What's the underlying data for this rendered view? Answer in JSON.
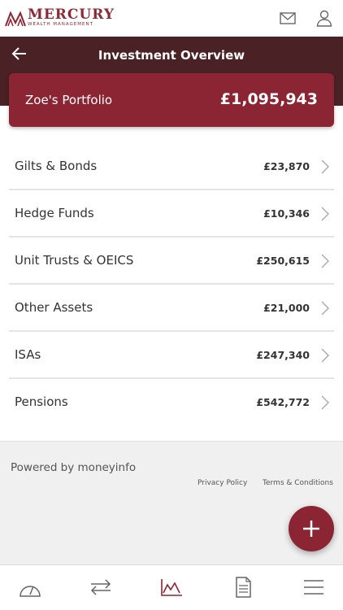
{
  "brand": {
    "name": "MERCURY",
    "subtitle": "WEALTH MANAGEMENT",
    "color": "#8b2533"
  },
  "header": {
    "title": "Investment Overview",
    "back_icon": "arrow-left-icon"
  },
  "portfolio": {
    "name": "Zoe's Portfolio",
    "total": "£1,095,943"
  },
  "assets": [
    {
      "name": "Gilts & Bonds",
      "value": "£23,870"
    },
    {
      "name": "Hedge Funds",
      "value": "£10,346"
    },
    {
      "name": "Unit Trusts & OEICS",
      "value": "£250,615"
    },
    {
      "name": "Other Assets",
      "value": "£21,000"
    },
    {
      "name": "ISAs",
      "value": "£247,340"
    },
    {
      "name": "Pensions",
      "value": "£542,772"
    }
  ],
  "footer": {
    "powered_by": "Powered by moneyinfo",
    "privacy": "Privacy Policy",
    "terms": "Terms & Conditions"
  },
  "nav": {
    "items": [
      "dashboard-icon",
      "transfer-icon",
      "chart-icon",
      "document-icon",
      "menu-icon"
    ],
    "active": "chart-icon"
  },
  "colors": {
    "header_band": "#4a2125",
    "accent": "#8b2533",
    "footer_bg": "#f0f0f0"
  }
}
